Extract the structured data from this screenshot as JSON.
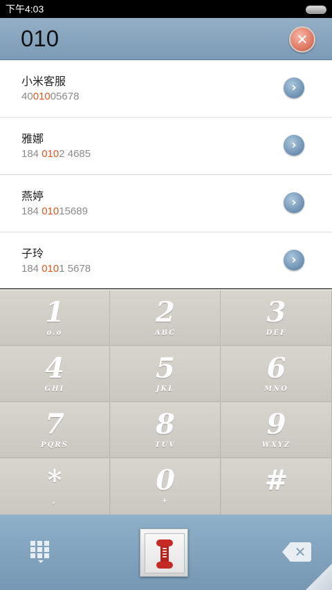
{
  "status_bar": {
    "time": "下午4:03"
  },
  "dialer": {
    "digits": "010"
  },
  "contacts": [
    {
      "name": "小米客服",
      "pre": "40",
      "match": "010",
      "post": "05678"
    },
    {
      "name": "雅娜",
      "pre": "184 ",
      "match": "010",
      "post": "2 4685"
    },
    {
      "name": "燕婷",
      "pre": "184 ",
      "match": "010",
      "post": "15689"
    },
    {
      "name": "子玲",
      "pre": "184 ",
      "match": "010",
      "post": "1 5678"
    }
  ],
  "keys": [
    {
      "digit": "1",
      "letters": "o.o"
    },
    {
      "digit": "2",
      "letters": "ABC"
    },
    {
      "digit": "3",
      "letters": "DEF"
    },
    {
      "digit": "4",
      "letters": "GHI"
    },
    {
      "digit": "5",
      "letters": "JKL"
    },
    {
      "digit": "6",
      "letters": "MNO"
    },
    {
      "digit": "7",
      "letters": "PQRS"
    },
    {
      "digit": "8",
      "letters": "TUV"
    },
    {
      "digit": "9",
      "letters": "WXYZ"
    },
    {
      "digit": "*",
      "letters": ","
    },
    {
      "digit": "0",
      "letters": "+"
    },
    {
      "digit": "#",
      "letters": ""
    }
  ],
  "icons": {
    "clear": "close-icon",
    "arrow": "chevron-right-icon",
    "keypad": "keypad-icon",
    "call": "phone-icon",
    "backspace": "backspace-icon"
  },
  "colors": {
    "match_highlight": "#e0561f",
    "header_blue": "#8aa8c0",
    "call_red": "#b8221e"
  }
}
